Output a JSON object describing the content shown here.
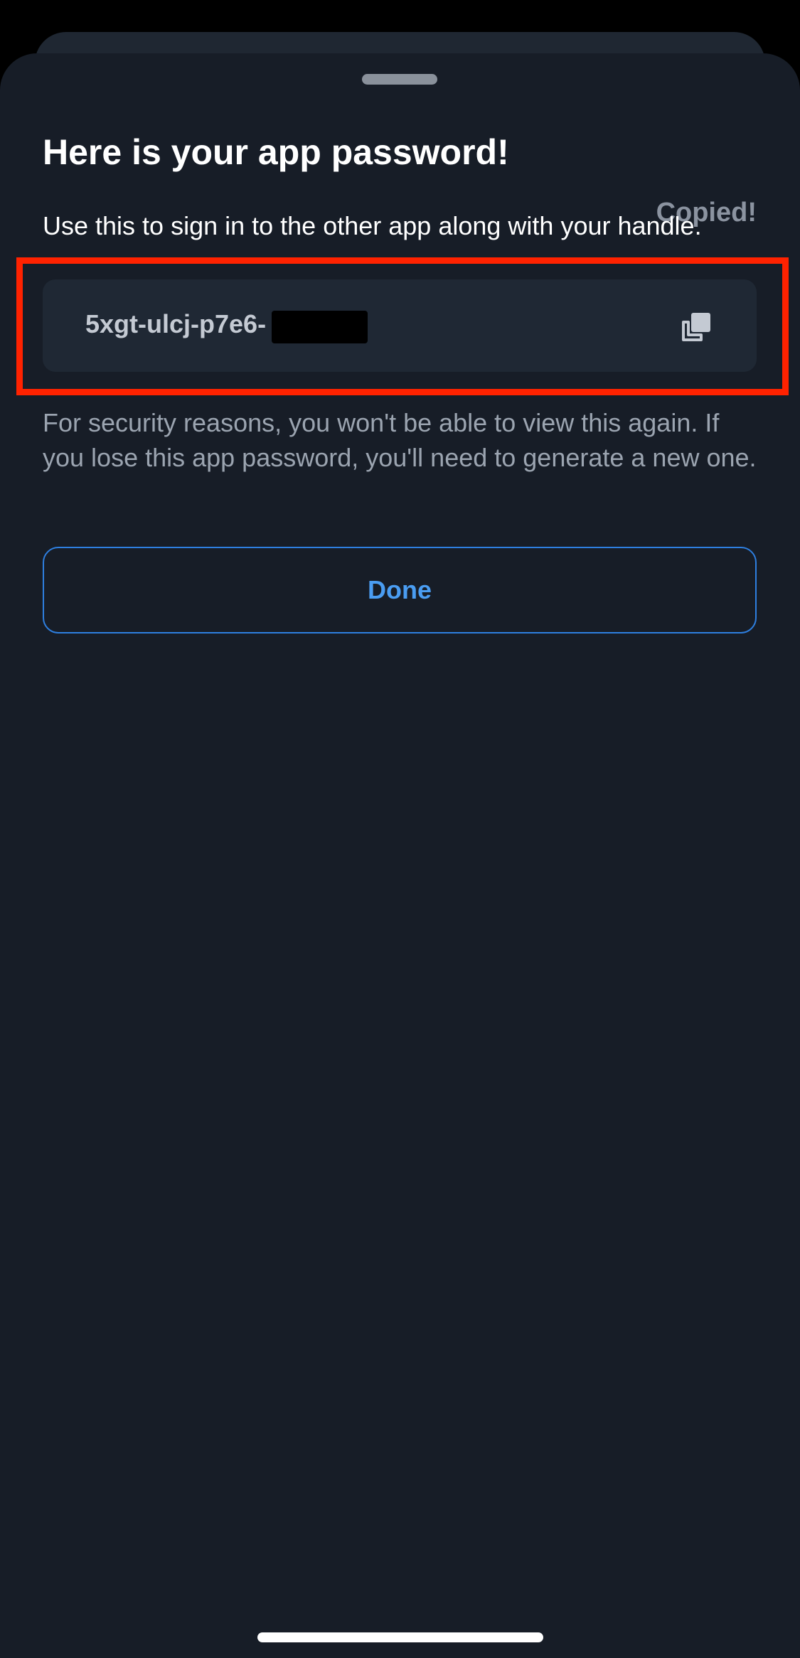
{
  "dialog": {
    "title": "Here is your app password!",
    "subtitle": "Use this to sign in to the other app along with your handle.",
    "copied_label": "Copied!",
    "password_visible": "5xgt-ulcj-p7e6-",
    "copy_icon": "copy-icon",
    "warning": "For security reasons, you won't be able to view this again. If you lose this app password, you'll need to generate a new one.",
    "done_label": "Done"
  },
  "colors": {
    "sheet_bg": "#171d27",
    "accent": "#4a9df2",
    "highlight": "#ff2200"
  }
}
